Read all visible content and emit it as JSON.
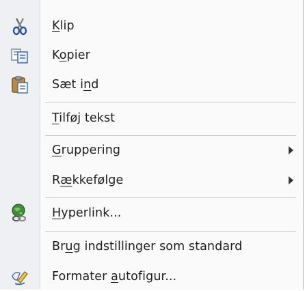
{
  "menu": {
    "items": [
      {
        "icon": "scissors-icon",
        "pre": "",
        "hotkey": "K",
        "post": "lip"
      },
      {
        "icon": "copy-icon",
        "pre": "K",
        "hotkey": "o",
        "post": "pier"
      },
      {
        "icon": "paste-icon",
        "pre": "Sæt i",
        "hotkey": "n",
        "post": "d"
      },
      {
        "icon": "",
        "pre": "",
        "hotkey": "T",
        "post": "ilføj tekst"
      },
      {
        "icon": "",
        "pre": "",
        "hotkey": "G",
        "post": "ruppering"
      },
      {
        "icon": "",
        "pre": "R",
        "hotkey": "æ",
        "post": "kkefølge"
      },
      {
        "icon": "hyperlink-globe-icon",
        "pre": "",
        "hotkey": "H",
        "post": "yperlink..."
      },
      {
        "icon": "",
        "pre": "Br",
        "hotkey": "u",
        "post": "g indstillinger som standard"
      },
      {
        "icon": "format-shape-icon",
        "pre": "Formater ",
        "hotkey": "a",
        "post": "utofigur..."
      }
    ],
    "submenu_arrows": [
      "submenu-arrow-icon",
      "submenu-arrow-icon"
    ]
  }
}
